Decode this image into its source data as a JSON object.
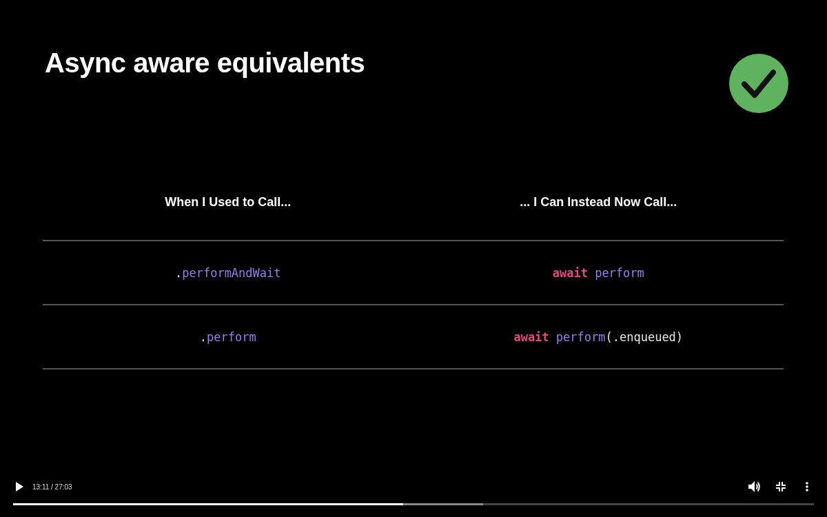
{
  "slide": {
    "title": "Async aware equivalents",
    "table": {
      "columns": [
        "When I Used to Call...",
        "... I Can Instead Now Call..."
      ],
      "rows": [
        [
          [
            {
              "kind": "punct",
              "text": "."
            },
            {
              "kind": "method",
              "text": "performAndWait"
            }
          ],
          [
            {
              "kind": "keyword",
              "text": "await"
            },
            {
              "kind": "punct",
              "text": " "
            },
            {
              "kind": "method",
              "text": "perform"
            }
          ]
        ],
        [
          [
            {
              "kind": "punct",
              "text": "."
            },
            {
              "kind": "method",
              "text": "perform"
            }
          ],
          [
            {
              "kind": "keyword",
              "text": "await"
            },
            {
              "kind": "punct",
              "text": " "
            },
            {
              "kind": "method",
              "text": "perform"
            },
            {
              "kind": "punct",
              "text": "(.enqueued)"
            }
          ]
        ]
      ]
    }
  },
  "player": {
    "playing": false,
    "time": "13:11 / 27:03",
    "progress": {
      "level": 0.487,
      "buffered": {
        "level": 0.587
      }
    }
  }
}
